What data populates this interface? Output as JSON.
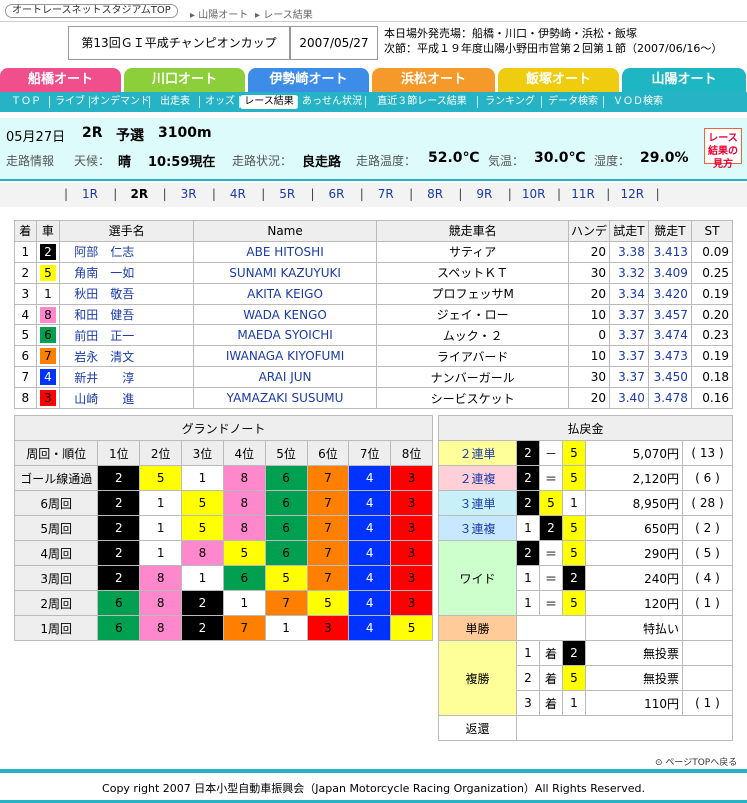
{
  "header": {
    "site_link": "オートレースネットスタジアムTOP",
    "crumb1": "山陽オート",
    "crumb2": "レース結果",
    "race_title": "第13回ＧＩ平成チャンピオンカップ",
    "date": "2007/05/27",
    "info1": "本日場外発売場：船橋・川口・伊勢崎・浜松・飯塚",
    "info2": "次節：平成１９年度山陽小野田市営第２回第１節（2007/06/16～）"
  },
  "venues": [
    {
      "label": "船橋オート",
      "color": "#f04f8c"
    },
    {
      "label": "川口オート",
      "color": "#8ccf3a"
    },
    {
      "label": "伊勢崎オート",
      "color": "#3d8ce8"
    },
    {
      "label": "浜松オート",
      "color": "#f59a2a"
    },
    {
      "label": "飯塚オート",
      "color": "#f0cc10"
    },
    {
      "label": "山陽オート",
      "color": "#1fb6c4"
    }
  ],
  "subnav": [
    "ＴＯＰ",
    "ライブ",
    "オンデマンド",
    "出走表",
    "オッズ",
    "レース結果",
    "あっせん状況",
    "直近３節レース結果",
    "ランキング",
    "データ検索",
    "ＶＯＤ検索"
  ],
  "race": {
    "date": "05月27日",
    "num": "2R",
    "kind": "予選",
    "dist": "3100m",
    "info_label": "走路情報",
    "weather_label": "天候：",
    "weather": "晴",
    "time": "10:59現在",
    "track_label": "走路状況：",
    "track": "良走路",
    "ttemp_label": "走路温度：",
    "ttemp": "52.0℃",
    "temp_label": "気温：",
    "temp": "30.0℃",
    "hum_label": "湿度：",
    "hum": "29.0%",
    "explain": "レース結果の見方"
  },
  "race_nav": [
    "1R",
    "2R",
    "3R",
    "4R",
    "5R",
    "6R",
    "7R",
    "8R",
    "9R",
    "10R",
    "11R",
    "12R"
  ],
  "entries_header": [
    "着",
    "車",
    "選手名",
    "Name",
    "競走車名",
    "ハンデ",
    "試走T",
    "競走T",
    "ST"
  ],
  "entries": [
    [
      "1",
      "2",
      "阿部　仁志",
      "ABE HITOSHI",
      "サティア",
      "20",
      "3.38",
      "3.413",
      "0.09"
    ],
    [
      "2",
      "5",
      "角南　一如",
      "SUNAMI KAZUYUKI",
      "スペットＫＴ",
      "30",
      "3.32",
      "3.409",
      "0.25"
    ],
    [
      "3",
      "1",
      "秋田　敬吾",
      "AKITA KEIGO",
      "プロフェッサM",
      "20",
      "3.34",
      "3.420",
      "0.19"
    ],
    [
      "4",
      "8",
      "和田　健吾",
      "WADA KENGO",
      "ジェイ・ロー",
      "10",
      "3.37",
      "3.457",
      "0.20"
    ],
    [
      "5",
      "6",
      "前田　正一",
      "MAEDA SYOICHI",
      "ムック・２",
      "0",
      "3.37",
      "3.474",
      "0.23"
    ],
    [
      "6",
      "7",
      "岩永　清文",
      "IWANAGA KIYOFUMI",
      "ライアバード",
      "10",
      "3.37",
      "3.473",
      "0.19"
    ],
    [
      "7",
      "4",
      "新井　　淳",
      "ARAI JUN",
      "ナンバーガール",
      "30",
      "3.37",
      "3.450",
      "0.18"
    ],
    [
      "8",
      "3",
      "山崎　　進",
      "YAMAZAKI SUSUMU",
      "シービスケット",
      "20",
      "3.40",
      "3.478",
      "0.16"
    ]
  ],
  "car_colors": {
    "1": "#ffffff",
    "2": "#000000",
    "3": "#ff0000",
    "4": "#0033ff",
    "5": "#ffff00",
    "6": "#00a050",
    "7": "#ff8000",
    "8": "#ff88cc"
  },
  "grand": {
    "title": "グランドノート",
    "header": [
      "周回・順位",
      "1位",
      "2位",
      "3位",
      "4位",
      "5位",
      "6位",
      "7位",
      "8位"
    ],
    "rows": [
      [
        "ゴール線通過",
        "2",
        "5",
        "1",
        "8",
        "6",
        "7",
        "4",
        "3"
      ],
      [
        "6周回",
        "2",
        "1",
        "5",
        "8",
        "6",
        "7",
        "4",
        "3"
      ],
      [
        "5周回",
        "2",
        "1",
        "5",
        "8",
        "6",
        "7",
        "4",
        "3"
      ],
      [
        "4周回",
        "2",
        "1",
        "8",
        "5",
        "6",
        "7",
        "4",
        "3"
      ],
      [
        "3周回",
        "2",
        "8",
        "1",
        "6",
        "5",
        "7",
        "4",
        "3"
      ],
      [
        "2周回",
        "6",
        "8",
        "2",
        "1",
        "7",
        "5",
        "4",
        "3"
      ],
      [
        "1周回",
        "6",
        "8",
        "2",
        "7",
        "1",
        "3",
        "4",
        "5"
      ]
    ]
  },
  "pay": {
    "title": "払戻金",
    "rows": [
      {
        "label": "２連単",
        "lc": "#ffff99",
        "a": "2",
        "s": "－",
        "b": "5",
        "c": "",
        "amt": "5,070円",
        "pop": "( 13 )"
      },
      {
        "label": "２連複",
        "lc": "#ffd0d8",
        "a": "2",
        "s": "＝",
        "b": "5",
        "c": "",
        "amt": "2,120円",
        "pop": "( 6 )"
      },
      {
        "label": "３連単",
        "lc": "#c8f0f8",
        "a": "2",
        "s": "",
        "b": "5",
        "c": "1",
        "amt": "8,950円",
        "pop": "( 28 )"
      },
      {
        "label": "３連複",
        "lc": "#c8e8ff",
        "a": "1",
        "s": "",
        "b": "2",
        "c": "5",
        "amt": "650円",
        "pop": "( 2 )"
      }
    ],
    "wide_label": "ワイド",
    "wide": [
      {
        "a": "2",
        "s": "＝",
        "b": "5",
        "amt": "290円",
        "pop": "( 5 )"
      },
      {
        "a": "1",
        "s": "＝",
        "b": "2",
        "amt": "240円",
        "pop": "( 4 )"
      },
      {
        "a": "1",
        "s": "＝",
        "b": "5",
        "amt": "120円",
        "pop": "( 1 )"
      }
    ],
    "tansho_label": "単勝",
    "tansho": "特払い",
    "fuku_label": "複勝",
    "fuku": [
      {
        "r": "1",
        "s": "着",
        "c": "2",
        "amt": "無投票",
        "pop": ""
      },
      {
        "r": "2",
        "s": "着",
        "c": "5",
        "amt": "無投票",
        "pop": ""
      },
      {
        "r": "3",
        "s": "着",
        "c": "1",
        "amt": "110円",
        "pop": "( 1 )"
      }
    ],
    "henkan_label": "返還"
  },
  "footer": {
    "pagetop": "ページTOPへ戻る",
    "copyright": "Copy right 2007 日本小型自動車振興会（Japan Motorcycle Racing Organization）All Rights Reserved."
  }
}
